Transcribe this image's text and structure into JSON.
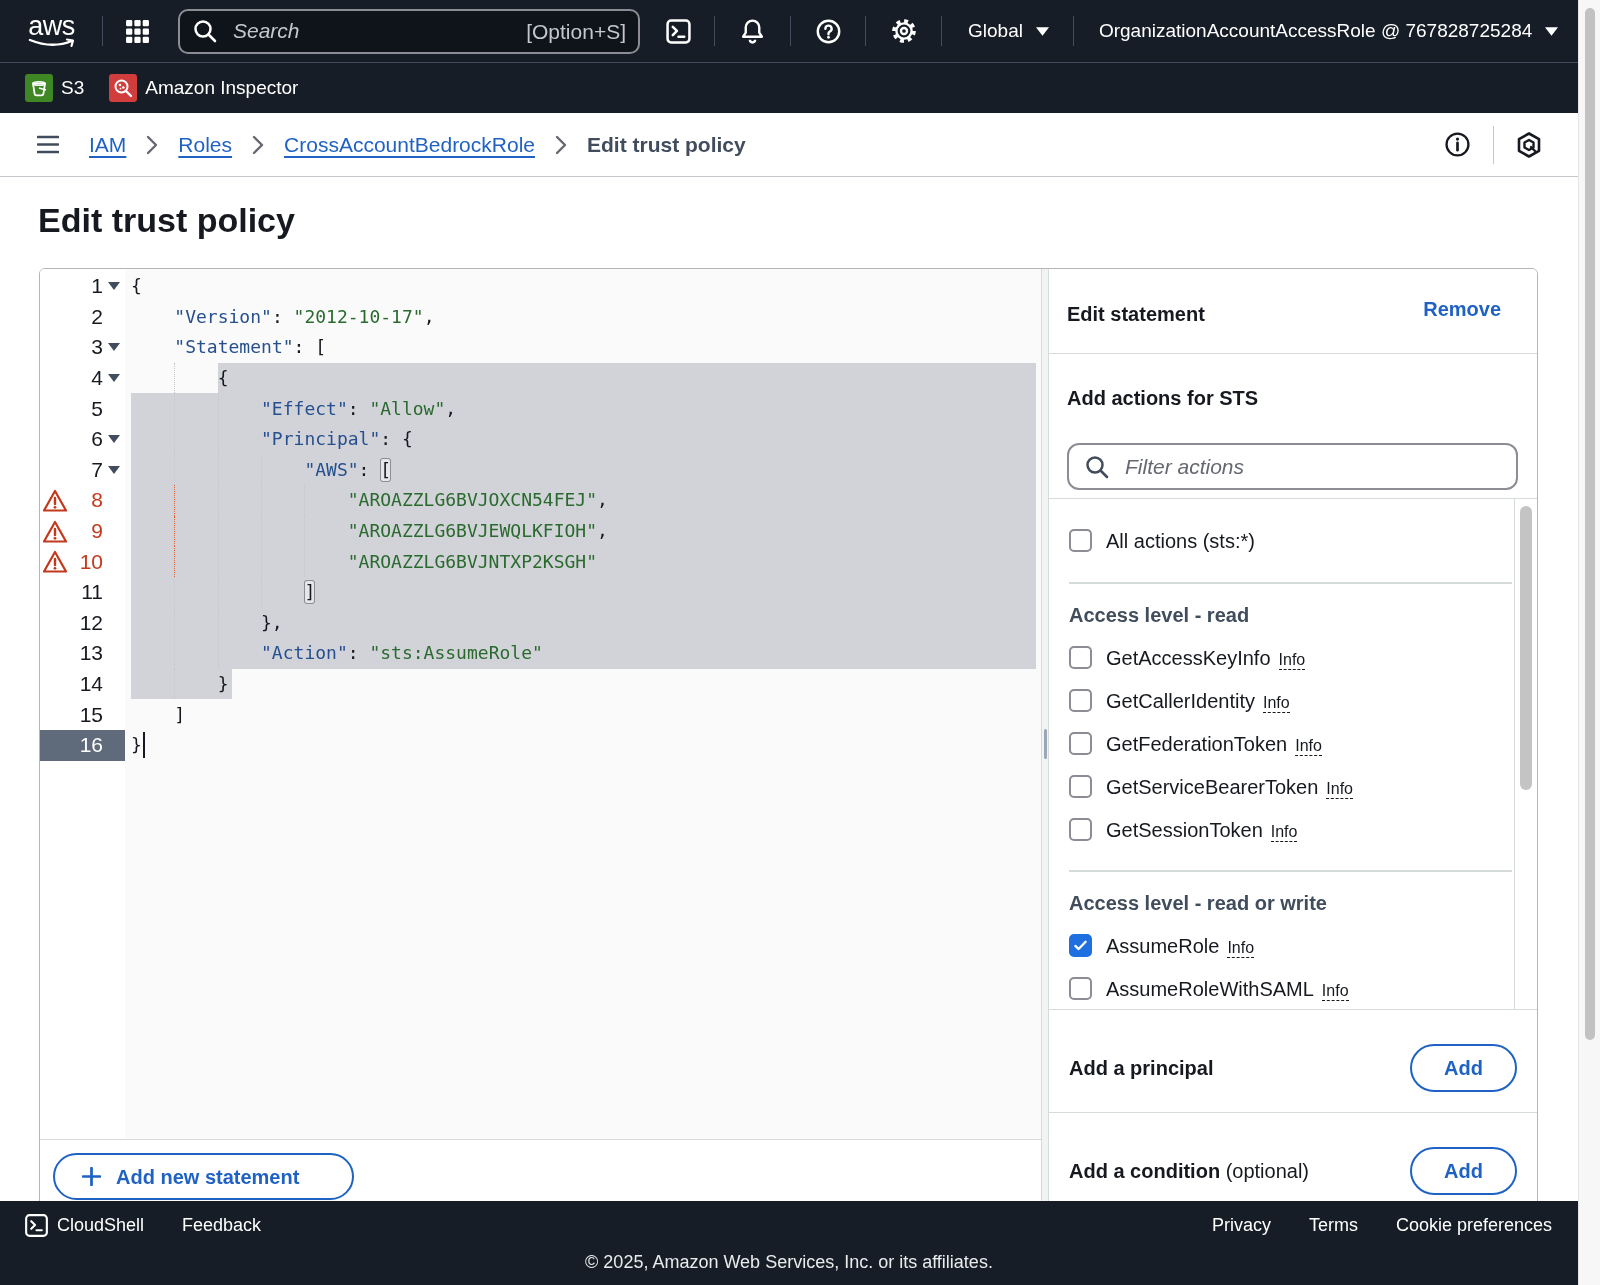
{
  "top_nav": {
    "logo": "aws",
    "search": {
      "placeholder": "Search",
      "shortcut": "[Option+S]"
    },
    "region": "Global",
    "account": "OrganizationAccountAccessRole @ 767828725284"
  },
  "favorites": [
    {
      "label": "S3",
      "kind": "storage",
      "color": "#3f8624"
    },
    {
      "label": "Amazon Inspector",
      "kind": "security",
      "color": "#d13c3c"
    }
  ],
  "breadcrumbs": [
    {
      "label": "IAM",
      "current": false
    },
    {
      "label": "Roles",
      "current": false
    },
    {
      "label": "CrossAccountBedrockRole",
      "current": false
    },
    {
      "label": "Edit trust policy",
      "current": true
    }
  ],
  "page_title": "Edit trust policy",
  "editor": {
    "lines": [
      {
        "number": "1",
        "text": "{",
        "fold_arrow": true,
        "warning": false,
        "selected": false,
        "bracket_match": false,
        "active": false
      },
      {
        "number": "2",
        "text": "    \"Version\": \"2012-10-17\",",
        "fold_arrow": false,
        "warning": false,
        "selected": false,
        "bracket_match": false,
        "active": false
      },
      {
        "number": "3",
        "text": "    \"Statement\": [",
        "fold_arrow": true,
        "warning": false,
        "selected": false,
        "bracket_match": false,
        "active": false
      },
      {
        "number": "4",
        "text": "        {",
        "fold_arrow": true,
        "warning": false,
        "selected": true,
        "bracket_match": false,
        "active": false
      },
      {
        "number": "5",
        "text": "            \"Effect\": \"Allow\",",
        "fold_arrow": false,
        "warning": false,
        "selected": true,
        "bracket_match": false,
        "active": false
      },
      {
        "number": "6",
        "text": "            \"Principal\": {",
        "fold_arrow": true,
        "warning": false,
        "selected": true,
        "bracket_match": false,
        "active": false
      },
      {
        "number": "7",
        "text": "                \"AWS\": [",
        "fold_arrow": true,
        "warning": false,
        "selected": true,
        "bracket_match": true,
        "active": false
      },
      {
        "number": "8",
        "text": "                    \"AROAZZLG6BVJOXCN54FEJ\",",
        "fold_arrow": false,
        "warning": true,
        "selected": true,
        "bracket_match": false,
        "active": false
      },
      {
        "number": "9",
        "text": "                    \"AROAZZLG6BVJEWQLKFIOH\",",
        "fold_arrow": false,
        "warning": true,
        "selected": true,
        "bracket_match": false,
        "active": false
      },
      {
        "number": "10",
        "text": "                    \"AROAZZLG6BVJNTXP2KSGH\"",
        "fold_arrow": false,
        "warning": true,
        "selected": true,
        "bracket_match": false,
        "active": false
      },
      {
        "number": "11",
        "text": "                ]",
        "fold_arrow": false,
        "warning": false,
        "selected": true,
        "bracket_match": true,
        "active": false
      },
      {
        "number": "12",
        "text": "            },",
        "fold_arrow": false,
        "warning": false,
        "selected": true,
        "bracket_match": false,
        "active": false
      },
      {
        "number": "13",
        "text": "            \"Action\": \"sts:AssumeRole\"",
        "fold_arrow": false,
        "warning": false,
        "selected": true,
        "bracket_match": false,
        "active": false
      },
      {
        "number": "14",
        "text": "        }",
        "fold_arrow": false,
        "warning": false,
        "selected": true,
        "bracket_match": false,
        "active": false
      },
      {
        "number": "15",
        "text": "    ]",
        "fold_arrow": false,
        "warning": false,
        "selected": false,
        "bracket_match": false,
        "active": false
      },
      {
        "number": "16",
        "text": "}",
        "fold_arrow": false,
        "warning": false,
        "selected": false,
        "bracket_match": false,
        "active": true
      }
    ]
  },
  "add_statement_button": "Add new statement",
  "statement_panel": {
    "title": "Edit statement",
    "remove_link": "Remove",
    "actions_heading": "Add actions for STS",
    "filter": {
      "placeholder": "Filter actions"
    },
    "all_actions": {
      "label": "All actions (sts:*)",
      "checked": false
    },
    "access_levels": [
      {
        "heading": "Access level - read",
        "actions": [
          {
            "label": "GetAccessKeyInfo",
            "info": "Info",
            "checked": false
          },
          {
            "label": "GetCallerIdentity",
            "info": "Info",
            "checked": false
          },
          {
            "label": "GetFederationToken",
            "info": "Info",
            "checked": false
          },
          {
            "label": "GetServiceBearerToken",
            "info": "Info",
            "checked": false
          },
          {
            "label": "GetSessionToken",
            "info": "Info",
            "checked": false
          }
        ]
      },
      {
        "heading": "Access level - read or write",
        "actions": [
          {
            "label": "AssumeRole",
            "info": "Info",
            "checked": true
          },
          {
            "label": "AssumeRoleWithSAML",
            "info": "Info",
            "checked": false
          }
        ]
      }
    ],
    "sections": [
      {
        "title": "Add a principal",
        "button": "Add"
      },
      {
        "title": "Add a condition",
        "note": "(optional)",
        "button": "Add"
      }
    ]
  },
  "footer": {
    "links_left": [
      {
        "label": "CloudShell",
        "kind": "icon"
      },
      {
        "label": "Feedback",
        "kind": "text"
      }
    ],
    "links_right": [
      "Privacy",
      "Terms",
      "Cookie preferences"
    ],
    "copyright": "© 2025, Amazon Web Services, Inc. or its affiliates."
  }
}
